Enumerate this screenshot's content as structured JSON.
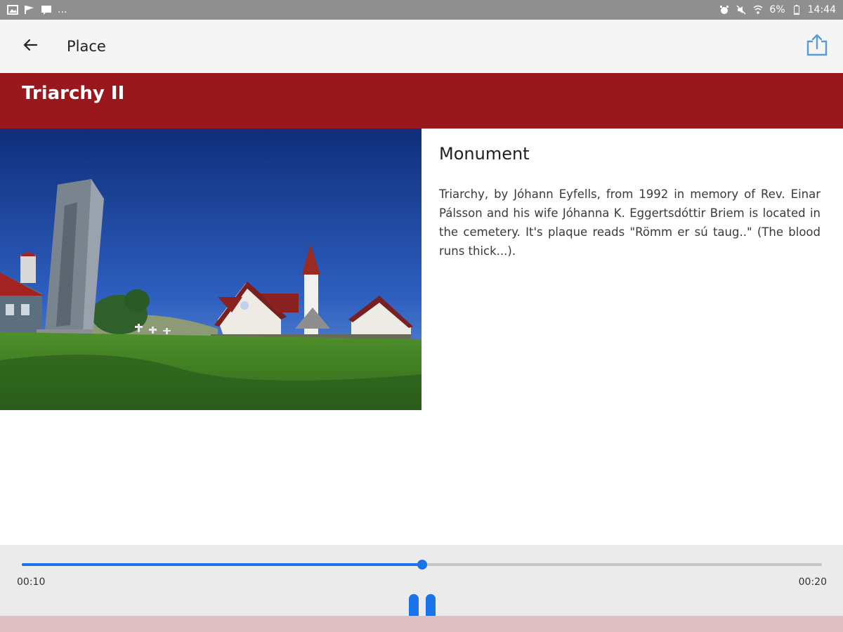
{
  "status_bar": {
    "left_icons": [
      "image-icon",
      "flag-icon",
      "message-icon"
    ],
    "left_more": "...",
    "right_icons": [
      "alarm-icon",
      "mute-icon",
      "wifi-icon"
    ],
    "battery_text": "6%",
    "time": "14:44"
  },
  "app_bar": {
    "title": "Place",
    "back_icon": "arrow-left-icon",
    "share_icon": "share-icon"
  },
  "place": {
    "name": "Triarchy II",
    "category": "Monument",
    "description": "Triarchy, by Jóhann Eyfells, from 1992 in memory of Rev. Einar Pálsson and his wife Jóhanna K. Eggertsdóttir Briem is located in the cemetery. It's plaque reads \"Römm er sú taug..\" (The blood runs thick...).",
    "photo_subject": "monument-and-church-photo"
  },
  "player": {
    "elapsed": "00:10",
    "total": "00:20",
    "progress": 0.5,
    "state_icon": "pause-icon"
  },
  "colors": {
    "brand_red": "#98181e",
    "accent_blue": "#1a73e8",
    "status_bar": "#8f8f8f"
  }
}
